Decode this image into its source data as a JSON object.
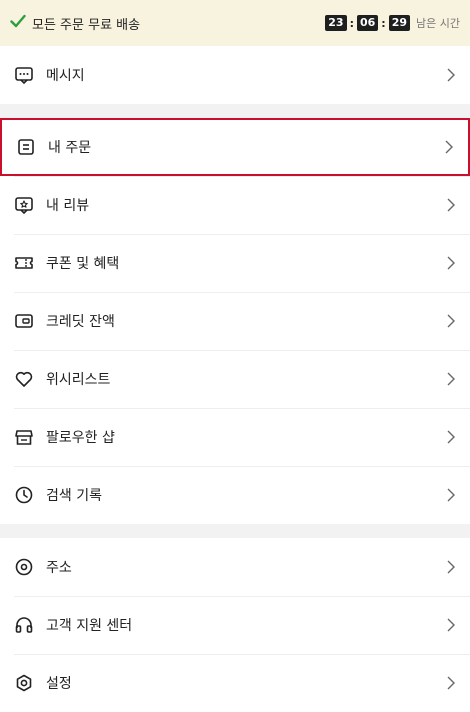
{
  "banner": {
    "text": "모든 주문 무료 배송",
    "countdown": {
      "hours": "23",
      "minutes": "06",
      "seconds": "29"
    },
    "remaining_label": "남은 시간",
    "accent": "#2e9e3f"
  },
  "menu": {
    "messages": "메시지",
    "my_orders": "내 주문",
    "my_reviews": "내 리뷰",
    "coupons": "쿠폰 및 혜택",
    "credit_balance": "크레딧 잔액",
    "wishlist": "위시리스트",
    "followed_shops": "팔로우한 샵",
    "search_history": "검색 기록",
    "address": "주소",
    "customer_support": "고객 지원 센터",
    "settings": "설정"
  },
  "highlight_color": "#c8102e"
}
